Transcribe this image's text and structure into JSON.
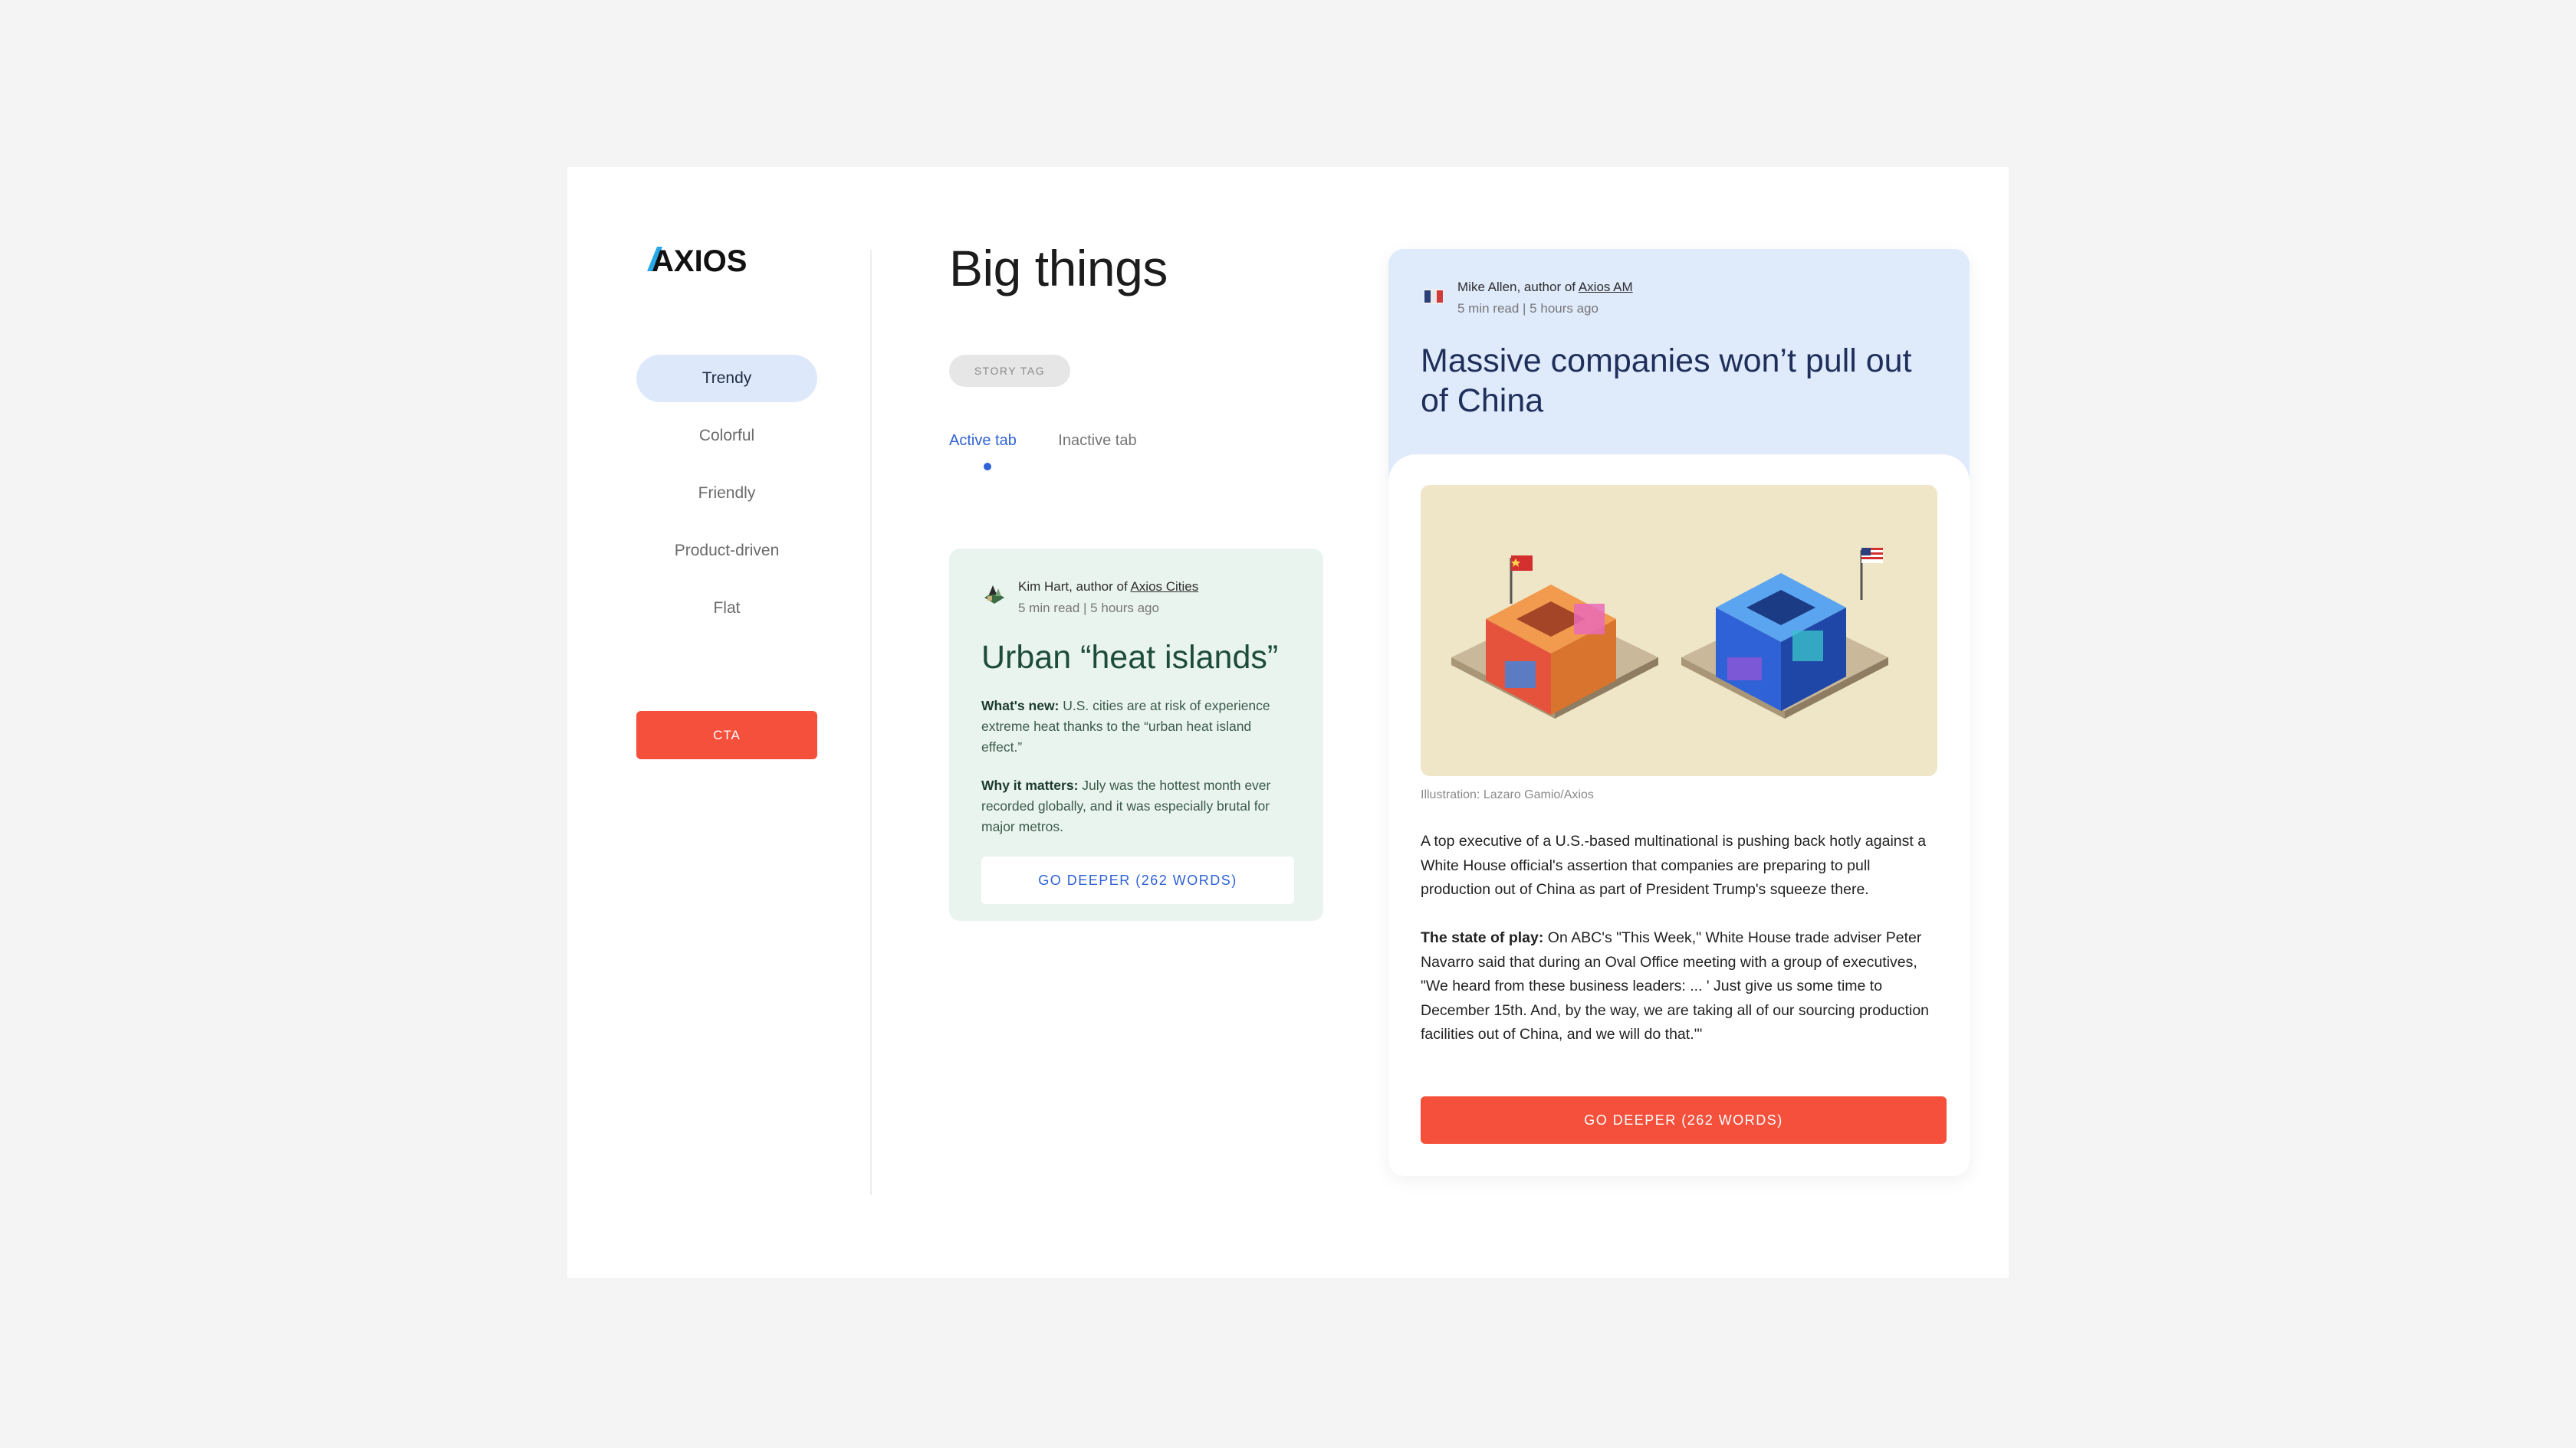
{
  "brand": {
    "logo_text": "AXIOS"
  },
  "sidebar": {
    "items": [
      {
        "label": "Trendy",
        "active": true
      },
      {
        "label": "Colorful"
      },
      {
        "label": "Friendly"
      },
      {
        "label": "Product-driven"
      },
      {
        "label": "Flat"
      }
    ],
    "cta_label": "CTA"
  },
  "main": {
    "title": "Big things",
    "story_tag": "STORY TAG",
    "tabs": [
      {
        "label": "Active tab",
        "active": true
      },
      {
        "label": "Inactive tab"
      }
    ]
  },
  "card_small": {
    "author_prefix": "Kim Hart, author of ",
    "author_link": "Axios Cities",
    "meta": "5 min read | 5 hours ago",
    "title": "Urban “heat islands”",
    "p1_label": "What's new:",
    "p1_text": " U.S. cities are at risk of experience extreme heat thanks to the “urban heat island effect.”",
    "p2_label": "Why it matters:",
    "p2_text": " July was the hottest month ever recorded globally, and it was especially brutal for major metros.",
    "button": "GO DEEPER (262 WORDS)"
  },
  "card_large": {
    "author_prefix": "Mike Allen, author of ",
    "author_link": "Axios AM",
    "meta": "5 min read | 5 hours ago",
    "title": "Massive companies won’t pull out of China",
    "caption": "Illustration: Lazaro Gamio/Axios",
    "body1": "A top executive of a U.S.-based multinational is pushing back hotly against a White House official's assertion that companies are preparing to pull production out of China as part of President Trump's squeeze there.",
    "body2_label": "The state of play:",
    "body2_text": " On ABC's \"This Week,\" White House trade adviser Peter Navarro said that during an Oval Office meeting with a group of executives, \"We heard from these business leaders: ... ' Just give us some time to December 15th. And, by the way, we are taking all of our sourcing production facilities out of China, and we will do that.'\"",
    "button": "GO DEEPER (262 WORDS)"
  },
  "colors": {
    "accent_blue": "#2f62d6",
    "cta_red": "#f4503c",
    "nav_active_bg": "#dde9fb",
    "card_green_bg": "#eaf4ef",
    "card_blue_bg": "#dfeafb"
  }
}
